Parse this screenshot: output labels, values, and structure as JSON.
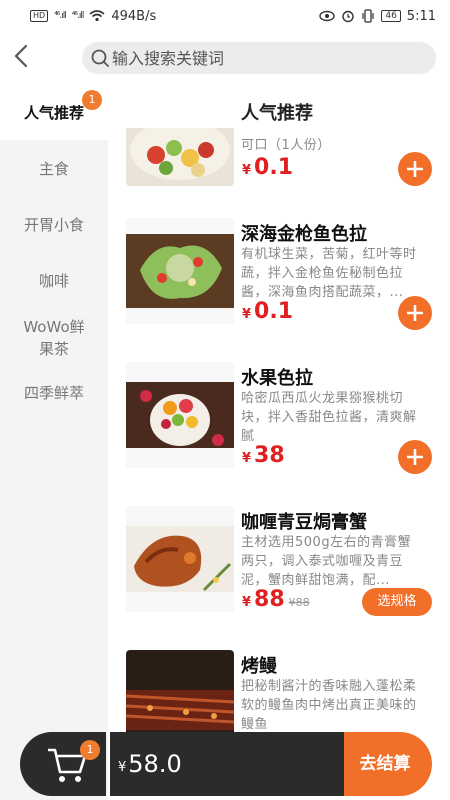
{
  "status_bar": {
    "left_badge": "HD",
    "sig1": "⁴⁶.ıll",
    "sig2": "⁴⁶.ıll",
    "net_speed": "494B/s",
    "battery": "46",
    "time": "5:11"
  },
  "search": {
    "placeholder": "输入搜索关键词"
  },
  "sidebar": {
    "items": [
      {
        "label": "人气推荐",
        "badge": "1"
      },
      {
        "label": "主食"
      },
      {
        "label": "开胃小食"
      },
      {
        "label": "咖啡"
      },
      {
        "label": "WoWo鲜果茶"
      },
      {
        "label": "四季鲜萃"
      }
    ]
  },
  "category_title": "人气推荐",
  "products": [
    {
      "name": "",
      "desc": "可口（1人份）",
      "currency": "¥",
      "price": "0.1"
    },
    {
      "name": "深海金枪鱼色拉",
      "desc": "有机球生菜，苦菊，红叶等时蔬，拌入金枪鱼佐秘制色拉酱，深海鱼肉搭配蔬菜，...",
      "currency": "¥",
      "price": "0.1"
    },
    {
      "name": "水果色拉",
      "desc": "哈密瓜西瓜火龙果猕猴桃切块，拌入香甜色拉酱，清爽解腻",
      "currency": "¥",
      "price": "38"
    },
    {
      "name": "咖喱青豆焗膏蟹",
      "desc": "主材选用500g左右的青膏蟹两只，调入泰式咖喱及青豆泥，蟹肉鲜甜饱满，配...",
      "currency": "¥",
      "price": "88",
      "old_price": "¥88",
      "spec_label": "选规格"
    },
    {
      "name": "烤鳗",
      "desc": "把秘制酱汁的香味融入蓬松柔软的鳗鱼肉中烤出真正美味的鳗鱼"
    }
  ],
  "cart": {
    "count": "1",
    "currency": "¥",
    "total": "58.0",
    "checkout_label": "去结算"
  },
  "colors": {
    "accent": "#f26f2a",
    "price": "#e02020",
    "dark_bar": "#2b2b2b"
  }
}
